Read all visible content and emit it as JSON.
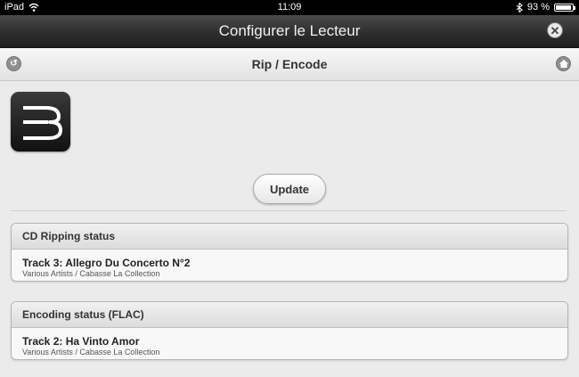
{
  "statusbar": {
    "device": "iPad",
    "time": "11:09",
    "battery": "93 %",
    "battery_level": 0.93
  },
  "window": {
    "title": "Configurer le Lecteur"
  },
  "nav": {
    "title": "Rip / Encode"
  },
  "actions": {
    "update_label": "Update"
  },
  "ripping": {
    "header": "CD Ripping status",
    "track": "Track 3: Allegro Du Concerto N°2",
    "subtitle": "Various Artists / Cabasse La Collection"
  },
  "encoding": {
    "header": "Encoding status (FLAC)",
    "track": "Track 2: Ha Vinto Amor",
    "subtitle": "Various Artists / Cabasse La Collection"
  },
  "icons": {
    "wifi": "wifi-icon",
    "bluetooth": "bluetooth-icon",
    "battery": "battery-icon",
    "close": "close-icon",
    "back": "back-icon",
    "home": "home-icon",
    "logo": "bluesound-logo-icon"
  },
  "colors": {
    "titlebar": "#2e2e2e",
    "navbar": "#e8e8e8",
    "background": "#ebebeb"
  }
}
